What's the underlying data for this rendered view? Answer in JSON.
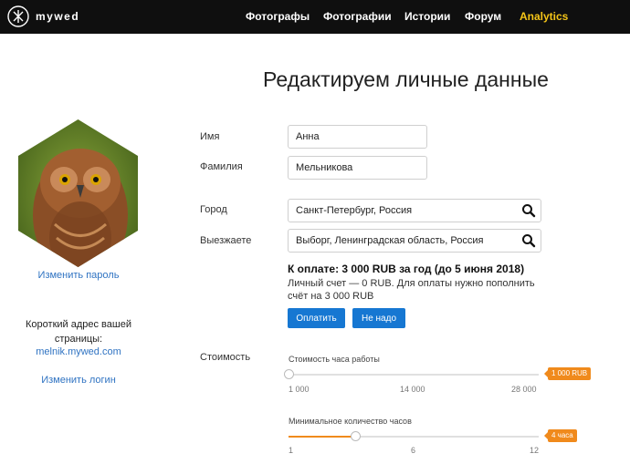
{
  "header": {
    "logo_text": "mywed",
    "nav": [
      "Фотографы",
      "Фотографии",
      "Истории",
      "Форум",
      "Analytics"
    ],
    "accent_color": "#f5c518"
  },
  "page_title": "Редактируем личные данные",
  "left": {
    "avatar_icon": "owl-photo",
    "change_password": "Изменить пароль",
    "short_address_label": "Короткий адрес вашей страницы:",
    "short_address_link": "melnik.mywed.com",
    "change_login": "Изменить логин"
  },
  "form": {
    "first_name_label": "Имя",
    "first_name_value": "Анна",
    "last_name_label": "Фамилия",
    "last_name_value": "Мельникова",
    "city_label": "Город",
    "city_value": "Санкт-Петербург, Россия",
    "travel_label": "Выезжаете",
    "travel_value": "Выборг, Ленинградская область, Россия",
    "search_icon": "search-icon"
  },
  "payment": {
    "title": "К оплате: 3 000 RUB за год (до 5 июня 2018)",
    "note": "Личный счет — 0 RUB. Для оплаты нужно пополнить счёт на 3 000 RUB",
    "pay_button": "Оплатить",
    "decline_button": "Не надо",
    "button_color": "#1677d2"
  },
  "cost": {
    "label": "Стоимость",
    "hour_rate": {
      "title": "Стоимость часа работы",
      "value_badge": "1 000 RUB",
      "ticks": [
        "1 000",
        "14 000",
        "28 000"
      ],
      "fraction": 0
    },
    "min_hours": {
      "title": "Минимальное количество часов",
      "value_badge": "4 часа",
      "ticks": [
        "1",
        "6",
        "12"
      ],
      "fraction": 0.27
    },
    "accent_color": "#f08a1c"
  }
}
